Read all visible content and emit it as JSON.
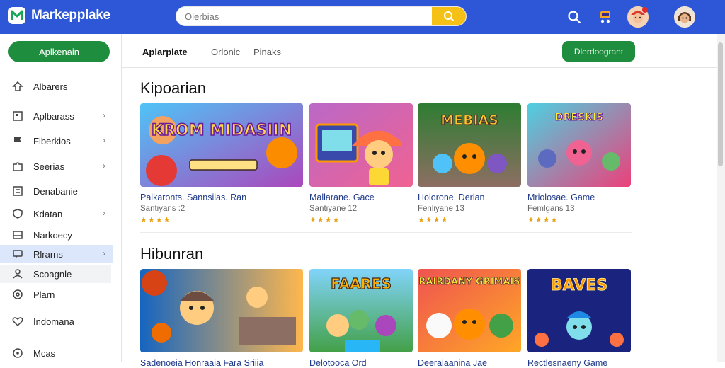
{
  "app": {
    "name": "Markepplake",
    "search_placeholder": "Olerbias"
  },
  "sidebar": {
    "primary_button": "Aplkenain",
    "items": [
      {
        "label": "Albarers",
        "icon": "tag-icon",
        "chevron": false
      },
      {
        "label": "Aplbarass",
        "icon": "grid-icon",
        "chevron": true
      },
      {
        "label": "Flberkios",
        "icon": "flag-icon",
        "chevron": true
      },
      {
        "label": "Seerias",
        "icon": "puzzle-icon",
        "chevron": true
      },
      {
        "label": "Denabanie",
        "icon": "list-icon",
        "chevron": false
      },
      {
        "label": "Kdatan",
        "icon": "shield-icon",
        "chevron": true
      },
      {
        "label": "Narkoecy",
        "icon": "square-icon",
        "chevron": false
      },
      {
        "label": "Rlrarns",
        "icon": "chat-icon",
        "chevron": true
      },
      {
        "label": "Scoagnle",
        "icon": "user-icon",
        "chevron": false
      },
      {
        "label": "Plarn",
        "icon": "settings-icon",
        "chevron": false
      },
      {
        "label": "Indomana",
        "icon": "heart-icon",
        "chevron": false
      },
      {
        "label": "Mcas",
        "icon": "circle-icon",
        "chevron": false
      }
    ]
  },
  "tabs": [
    {
      "label": "Aplarplate",
      "active": true
    },
    {
      "label": "Orlonic",
      "active": false
    },
    {
      "label": "Pinaks",
      "active": false
    }
  ],
  "download_button": "Dlerdoogrant",
  "sections": [
    {
      "title": "Kipoarian",
      "cards": [
        {
          "title": "Palkaronts. Sannsilas. Ran",
          "subtitle": "Santiyans :2",
          "stars": "★★★★",
          "art": "KROM MIDASIIN"
        },
        {
          "title": "Mallarane. Gace",
          "subtitle": "Santiyane 12",
          "stars": "★★★★",
          "art": ""
        },
        {
          "title": "Holorone. Derlan",
          "subtitle": "Fenliyane 13",
          "stars": "★★★★",
          "art": "MEBIAS"
        },
        {
          "title": "Mriolosae. Game",
          "subtitle": "Femlgans 13",
          "stars": "★★★★",
          "art": "DRESKIS"
        }
      ]
    },
    {
      "title": "Hibunran",
      "cards": [
        {
          "title": "Sadenoeia Honraaia Fara Sriiia",
          "art": ""
        },
        {
          "title": "Delotooca Ord",
          "art": "FAARES"
        },
        {
          "title": "Deeralaanina Jae",
          "art": "RAIRDANY GRIMAIS"
        },
        {
          "title": "Rectlesnaeny Game",
          "art": "BAVES"
        }
      ]
    }
  ],
  "colors": {
    "topbar": "#2d57d6",
    "accent_green": "#1e8e3e",
    "search_button": "#f5c116",
    "stars": "#e8a317",
    "sidebar_active": "#dde7fb"
  }
}
